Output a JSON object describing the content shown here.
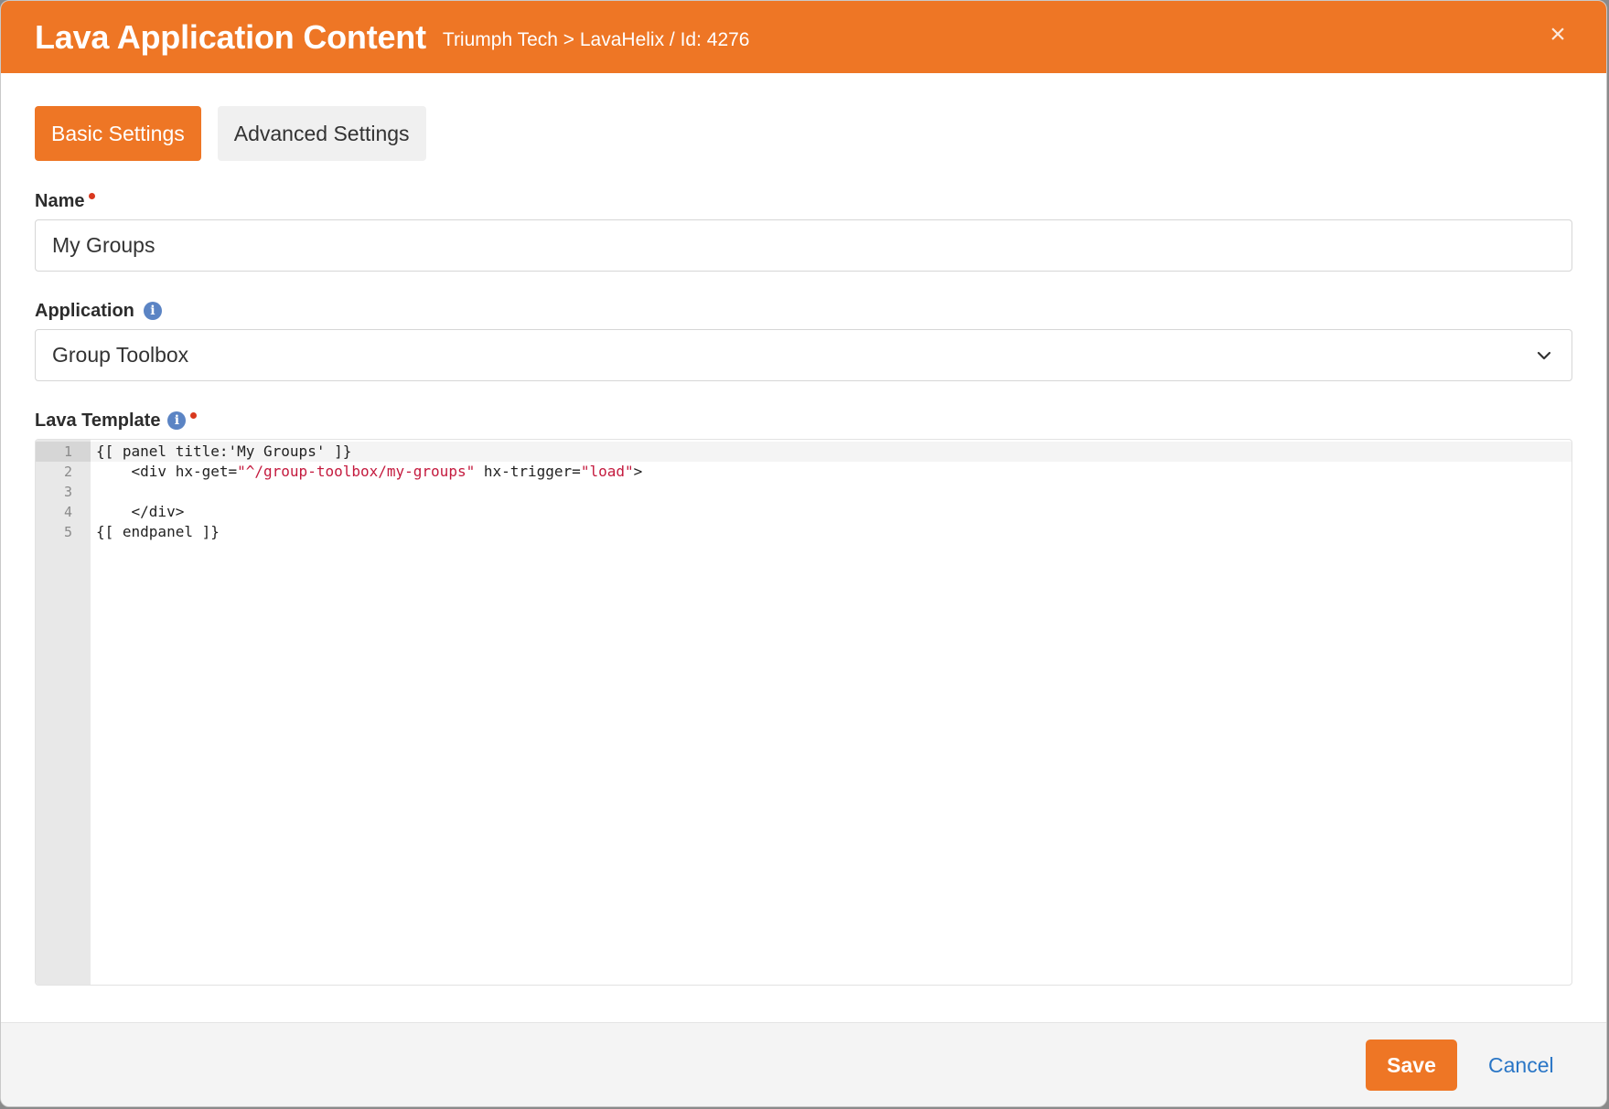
{
  "dialog": {
    "title": "Lava Application Content",
    "subtitle": "Triumph Tech > LavaHelix / Id: 4276",
    "close_glyph": "×"
  },
  "tabs": [
    {
      "label": "Basic Settings",
      "active": true
    },
    {
      "label": "Advanced Settings",
      "active": false
    }
  ],
  "fields": {
    "name": {
      "label": "Name",
      "value": "My Groups",
      "required": true
    },
    "application": {
      "label": "Application",
      "value": "Group Toolbox",
      "has_info": true
    },
    "lava_template": {
      "label": "Lava Template",
      "has_info": true,
      "required": true
    }
  },
  "code_editor": {
    "line_numbers": [
      "1",
      "2",
      "3",
      "4",
      "5"
    ],
    "lines": [
      {
        "parts": [
          {
            "text": "{[ panel title:'My Groups' ]}",
            "type": "plain"
          }
        ]
      },
      {
        "parts": [
          {
            "text": "    <div hx-get=",
            "type": "plain"
          },
          {
            "text": "\"^/group-toolbox/my-groups\"",
            "type": "string"
          },
          {
            "text": " hx-trigger=",
            "type": "plain"
          },
          {
            "text": "\"load\"",
            "type": "string"
          },
          {
            "text": ">",
            "type": "plain"
          }
        ]
      },
      {
        "parts": [
          {
            "text": "",
            "type": "plain"
          }
        ]
      },
      {
        "parts": [
          {
            "text": "    </div>",
            "type": "plain"
          }
        ]
      },
      {
        "parts": [
          {
            "text": "{[ endpanel ]}",
            "type": "plain"
          }
        ]
      }
    ]
  },
  "footer": {
    "save_label": "Save",
    "cancel_label": "Cancel"
  },
  "colors": {
    "accent": "#ee7625",
    "link": "#2a76c6",
    "required": "#d9381e",
    "info": "#5b84c4",
    "code_string": "#c41a3e"
  },
  "icons": {
    "close": "close-icon",
    "info": "info-icon",
    "dropdown": "chevron-down-icon"
  }
}
